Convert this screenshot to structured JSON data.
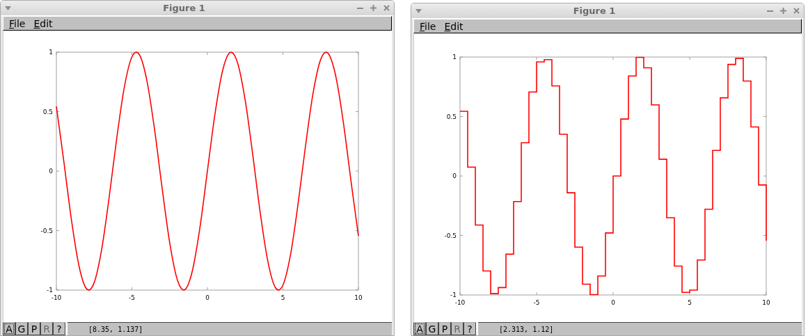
{
  "windows": [
    {
      "title": "Figure 1",
      "menu": [
        "File",
        "Edit"
      ],
      "chart_data": {
        "type": "line",
        "x": [
          -10,
          -9.5,
          -9,
          -8.5,
          -8,
          -7.5,
          -7,
          -6.5,
          -6,
          -5.5,
          -5,
          -4.5,
          -4,
          -3.5,
          -3,
          -2.5,
          -2,
          -1.5,
          -1,
          -0.5,
          0,
          0.5,
          1,
          1.5,
          2,
          2.5,
          3,
          3.5,
          4,
          4.5,
          5,
          5.5,
          6,
          6.5,
          7,
          7.5,
          8,
          8.5,
          9,
          9.5,
          10
        ],
        "series": [
          {
            "color": "#ff0000",
            "values": [
              0.544,
              0.075,
              -0.412,
              -0.798,
              -0.989,
              -0.938,
              -0.657,
              -0.215,
              0.279,
              0.706,
              0.959,
              0.978,
              0.757,
              0.351,
              -0.141,
              -0.598,
              -0.909,
              -0.997,
              -0.841,
              -0.479,
              0,
              0.479,
              0.841,
              0.997,
              0.909,
              0.598,
              0.141,
              -0.351,
              -0.757,
              -0.978,
              -0.959,
              -0.706,
              -0.279,
              0.215,
              0.657,
              0.938,
              0.989,
              0.798,
              0.412,
              -0.075,
              -0.544
            ]
          }
        ],
        "xlim": [
          -10,
          10
        ],
        "ylim": [
          -1,
          1
        ],
        "xticks": [
          -10,
          -5,
          0,
          5,
          10
        ],
        "yticks": [
          -1,
          -0.5,
          0,
          0.5,
          1
        ]
      },
      "toolbar": [
        {
          "label": "A",
          "selected": true,
          "disabled": false
        },
        {
          "label": "G",
          "selected": false,
          "disabled": false
        },
        {
          "label": "P",
          "selected": false,
          "disabled": false
        },
        {
          "label": "R",
          "selected": false,
          "disabled": true
        },
        {
          "label": "?",
          "selected": false,
          "disabled": false
        }
      ],
      "status": "[8.35, 1.137]"
    },
    {
      "title": "Figure 1",
      "menu": [
        "File",
        "Edit"
      ],
      "chart_data": {
        "type": "line",
        "x": [
          -10,
          -9.5,
          -9.5,
          -9,
          -9,
          -8.5,
          -8.5,
          -8,
          -8,
          -7.5,
          -7.5,
          -7,
          -7,
          -6.5,
          -6.5,
          -6,
          -6,
          -5.5,
          -5.5,
          -5,
          -5,
          -4.5,
          -4.5,
          -4,
          -4,
          -3.5,
          -3.5,
          -3,
          -3,
          -2.5,
          -2.5,
          -2,
          -2,
          -1.5,
          -1.5,
          -1,
          -1,
          -0.5,
          -0.5,
          0,
          0,
          0.5,
          0.5,
          1,
          1,
          1.5,
          1.5,
          2,
          2,
          2.5,
          2.5,
          3,
          3,
          3.5,
          3.5,
          4,
          4,
          4.5,
          4.5,
          5,
          5,
          5.5,
          5.5,
          6,
          6,
          6.5,
          6.5,
          7,
          7,
          7.5,
          7.5,
          8,
          8,
          8.5,
          8.5,
          9,
          9,
          9.5,
          9.5,
          10,
          10
        ],
        "series": [
          {
            "color": "#ff0000",
            "values": [
              0.544,
              0.544,
              0.075,
              0.075,
              -0.412,
              -0.412,
              -0.798,
              -0.798,
              -0.989,
              -0.989,
              -0.938,
              -0.938,
              -0.657,
              -0.657,
              -0.215,
              -0.215,
              0.279,
              0.279,
              0.706,
              0.706,
              0.959,
              0.959,
              0.978,
              0.978,
              0.757,
              0.757,
              0.351,
              0.351,
              -0.141,
              -0.141,
              -0.598,
              -0.598,
              -0.909,
              -0.909,
              -0.997,
              -0.997,
              -0.841,
              -0.841,
              -0.479,
              -0.479,
              0,
              0,
              0.479,
              0.479,
              0.841,
              0.841,
              0.997,
              0.997,
              0.909,
              0.909,
              0.598,
              0.598,
              0.141,
              0.141,
              -0.351,
              -0.351,
              -0.757,
              -0.757,
              -0.978,
              -0.978,
              -0.959,
              -0.959,
              -0.706,
              -0.706,
              -0.279,
              -0.279,
              0.215,
              0.215,
              0.657,
              0.657,
              0.938,
              0.938,
              0.989,
              0.989,
              0.798,
              0.798,
              0.412,
              0.412,
              -0.075,
              -0.075,
              -0.544
            ]
          }
        ],
        "xlim": [
          -10,
          10
        ],
        "ylim": [
          -1,
          1
        ],
        "xticks": [
          -10,
          -5,
          0,
          5,
          10
        ],
        "yticks": [
          -1,
          -0.5,
          0,
          0.5,
          1
        ]
      },
      "toolbar": [
        {
          "label": "A",
          "selected": true,
          "disabled": false
        },
        {
          "label": "G",
          "selected": false,
          "disabled": false
        },
        {
          "label": "P",
          "selected": false,
          "disabled": false
        },
        {
          "label": "R",
          "selected": false,
          "disabled": true
        },
        {
          "label": "?",
          "selected": false,
          "disabled": false
        }
      ],
      "status": "[2.313, 1.12]"
    }
  ]
}
